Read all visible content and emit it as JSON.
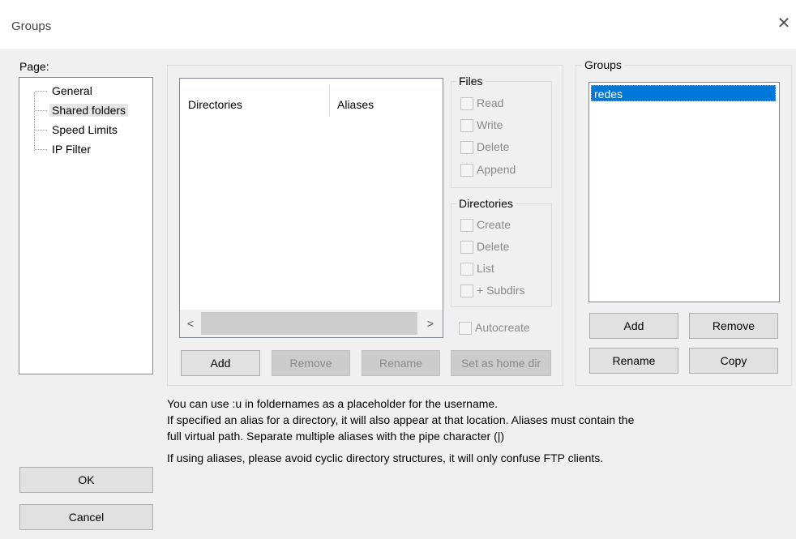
{
  "window": {
    "title": "Groups",
    "close_glyph": "✕"
  },
  "page": {
    "label": "Page:",
    "items": [
      "General",
      "Shared folders",
      "Speed Limits",
      "IP Filter"
    ],
    "selected": "Shared folders"
  },
  "shared": {
    "columns": [
      "Directories",
      "Aliases"
    ],
    "scroll_left": "<",
    "scroll_right": ">",
    "buttons": {
      "add": "Add",
      "remove": "Remove",
      "rename": "Rename",
      "set_home": "Set as home dir"
    }
  },
  "files": {
    "legend": "Files",
    "options": [
      "Read",
      "Write",
      "Delete",
      "Append"
    ]
  },
  "directories": {
    "legend": "Directories",
    "options": [
      "Create",
      "Delete",
      "List",
      "+ Subdirs"
    ]
  },
  "autocreate": "Autocreate",
  "groups": {
    "title": "Groups",
    "items": [
      "redes"
    ],
    "selected": "redes",
    "buttons": {
      "add": "Add",
      "remove": "Remove",
      "rename": "Rename",
      "copy": "Copy"
    }
  },
  "info": {
    "line1": "You can use :u in foldernames as a placeholder for the username.",
    "line2": "If specified an alias for a directory, it will also appear at that location. Aliases must contain the",
    "line3": "full virtual path. Separate multiple aliases with the pipe character (|)",
    "line4": "If using aliases, please avoid cyclic directory structures, it will only confuse FTP clients."
  },
  "dialog_buttons": {
    "ok": "OK",
    "cancel": "Cancel"
  },
  "colors": {
    "selection": "#0078d7",
    "background": "#f0f0f0"
  }
}
